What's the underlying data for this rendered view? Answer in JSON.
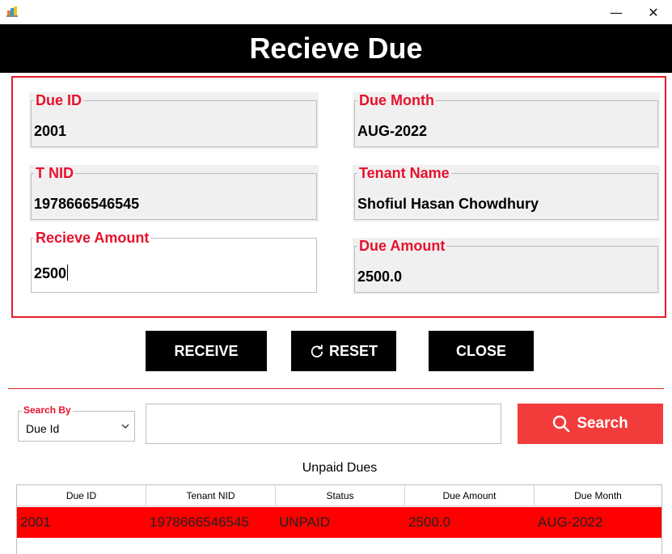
{
  "window": {
    "minimize_glyph": "—",
    "close_glyph": "✕"
  },
  "header": {
    "title": "Recieve Due"
  },
  "form": {
    "due_id": {
      "label": "Due ID",
      "value": "2001"
    },
    "due_month": {
      "label": "Due Month",
      "value": "AUG-2022"
    },
    "t_nid": {
      "label": "T NID",
      "value": "1978666546545"
    },
    "tenant_name": {
      "label": "Tenant Name",
      "value": "Shofiul Hasan Chowdhury"
    },
    "receive_amount": {
      "label": "Recieve Amount",
      "value": "2500"
    },
    "due_amount": {
      "label": "Due Amount",
      "value": "2500.0"
    }
  },
  "buttons": {
    "receive": "RECEIVE",
    "reset": "RESET",
    "close": "CLOSE"
  },
  "search": {
    "by_label": "Search By",
    "by_selected": "Due Id",
    "query": "",
    "button": "Search"
  },
  "table": {
    "title": "Unpaid Dues",
    "columns": [
      "Due ID",
      "Tenant NID",
      "Status",
      "Due Amount",
      "Due Month"
    ],
    "rows": [
      [
        "2001",
        "1978666546545",
        "UNPAID",
        "2500.0",
        "AUG-2022"
      ]
    ]
  },
  "colors": {
    "accent_red": "#e8112d",
    "search_button": "#f23c3c",
    "selected_row": "#ff0000",
    "header_bg": "#000000"
  },
  "icons": {
    "app": "app-icon",
    "reset": "refresh-icon",
    "search": "search-icon",
    "dropdown": "chevron-down-icon"
  }
}
